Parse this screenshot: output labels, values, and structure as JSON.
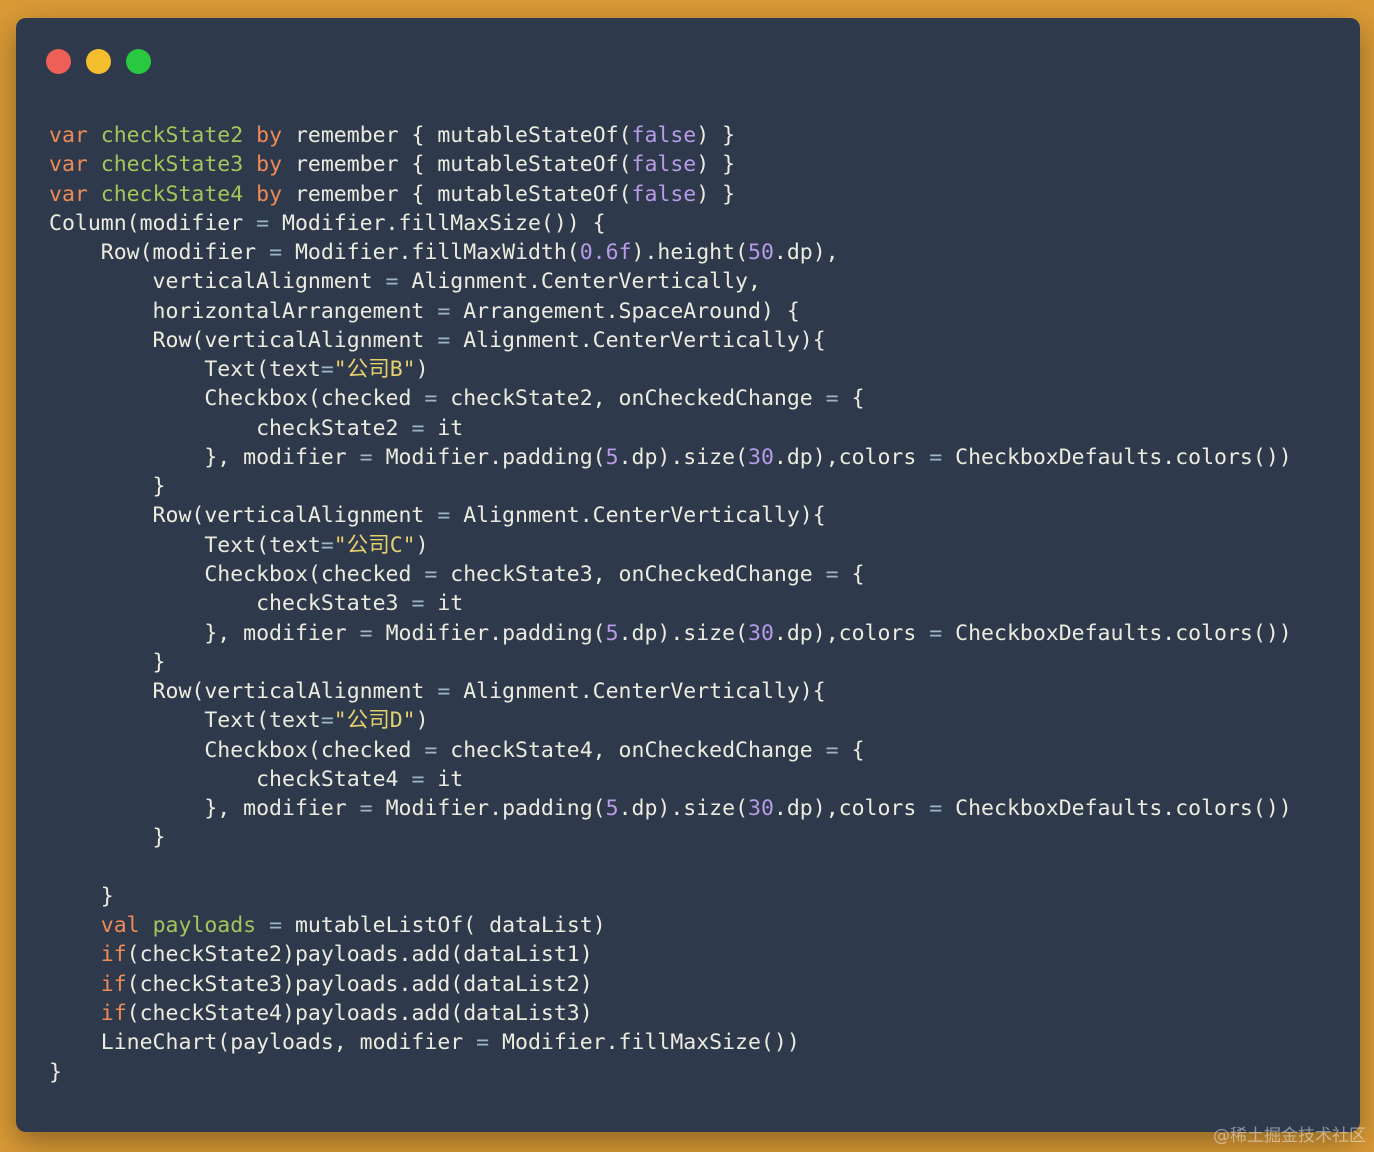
{
  "window": {
    "controls": {
      "close_icon": "red-circle",
      "minimize_icon": "yellow-circle",
      "maximize_icon": "green-circle"
    }
  },
  "colors": {
    "background": "#d99a36",
    "window": "#2e3a4c",
    "keyword": "#ef8a55",
    "variable": "#a7c45b",
    "plain": "#ecebdf",
    "operator": "#9fb6c9",
    "literal": "#b89be6",
    "string": "#e5cf6e"
  },
  "code": {
    "lines": [
      [
        [
          "kw",
          "var"
        ],
        [
          "plain",
          " "
        ],
        [
          "var",
          "checkState2"
        ],
        [
          "plain",
          " "
        ],
        [
          "kw",
          "by"
        ],
        [
          "plain",
          " remember { mutableStateOf("
        ],
        [
          "bool",
          "false"
        ],
        [
          "plain",
          ") }"
        ]
      ],
      [
        [
          "kw",
          "var"
        ],
        [
          "plain",
          " "
        ],
        [
          "var",
          "checkState3"
        ],
        [
          "plain",
          " "
        ],
        [
          "kw",
          "by"
        ],
        [
          "plain",
          " remember { mutableStateOf("
        ],
        [
          "bool",
          "false"
        ],
        [
          "plain",
          ") }"
        ]
      ],
      [
        [
          "kw",
          "var"
        ],
        [
          "plain",
          " "
        ],
        [
          "var",
          "checkState4"
        ],
        [
          "plain",
          " "
        ],
        [
          "kw",
          "by"
        ],
        [
          "plain",
          " remember { mutableStateOf("
        ],
        [
          "bool",
          "false"
        ],
        [
          "plain",
          ") }"
        ]
      ],
      [
        [
          "plain",
          "Column(modifier "
        ],
        [
          "op",
          "="
        ],
        [
          "plain",
          " Modifier.fillMaxSize()) {"
        ]
      ],
      [
        [
          "plain",
          "    Row(modifier "
        ],
        [
          "op",
          "="
        ],
        [
          "plain",
          " Modifier.fillMaxWidth("
        ],
        [
          "num",
          "0.6f"
        ],
        [
          "plain",
          ").height("
        ],
        [
          "num",
          "50"
        ],
        [
          "plain",
          ".dp),"
        ]
      ],
      [
        [
          "plain",
          "        verticalAlignment "
        ],
        [
          "op",
          "="
        ],
        [
          "plain",
          " Alignment.CenterVertically,"
        ]
      ],
      [
        [
          "plain",
          "        horizontalArrangement "
        ],
        [
          "op",
          "="
        ],
        [
          "plain",
          " Arrangement.SpaceAround) {"
        ]
      ],
      [
        [
          "plain",
          "        Row(verticalAlignment "
        ],
        [
          "op",
          "="
        ],
        [
          "plain",
          " Alignment.CenterVertically){"
        ]
      ],
      [
        [
          "plain",
          "            Text(text"
        ],
        [
          "op",
          "="
        ],
        [
          "str",
          "\"公司B\""
        ],
        [
          "plain",
          ")"
        ]
      ],
      [
        [
          "plain",
          "            Checkbox(checked "
        ],
        [
          "op",
          "="
        ],
        [
          "plain",
          " checkState2, onCheckedChange "
        ],
        [
          "op",
          "="
        ],
        [
          "plain",
          " {"
        ]
      ],
      [
        [
          "plain",
          "                checkState2 "
        ],
        [
          "op",
          "="
        ],
        [
          "plain",
          " it"
        ]
      ],
      [
        [
          "plain",
          "            }, modifier "
        ],
        [
          "op",
          "="
        ],
        [
          "plain",
          " Modifier.padding("
        ],
        [
          "num",
          "5"
        ],
        [
          "plain",
          ".dp).size("
        ],
        [
          "num",
          "30"
        ],
        [
          "plain",
          ".dp),colors "
        ],
        [
          "op",
          "="
        ],
        [
          "plain",
          " CheckboxDefaults.colors())"
        ]
      ],
      [
        [
          "plain",
          "        }"
        ]
      ],
      [
        [
          "plain",
          "        Row(verticalAlignment "
        ],
        [
          "op",
          "="
        ],
        [
          "plain",
          " Alignment.CenterVertically){"
        ]
      ],
      [
        [
          "plain",
          "            Text(text"
        ],
        [
          "op",
          "="
        ],
        [
          "str",
          "\"公司C\""
        ],
        [
          "plain",
          ")"
        ]
      ],
      [
        [
          "plain",
          "            Checkbox(checked "
        ],
        [
          "op",
          "="
        ],
        [
          "plain",
          " checkState3, onCheckedChange "
        ],
        [
          "op",
          "="
        ],
        [
          "plain",
          " {"
        ]
      ],
      [
        [
          "plain",
          "                checkState3 "
        ],
        [
          "op",
          "="
        ],
        [
          "plain",
          " it"
        ]
      ],
      [
        [
          "plain",
          "            }, modifier "
        ],
        [
          "op",
          "="
        ],
        [
          "plain",
          " Modifier.padding("
        ],
        [
          "num",
          "5"
        ],
        [
          "plain",
          ".dp).size("
        ],
        [
          "num",
          "30"
        ],
        [
          "plain",
          ".dp),colors "
        ],
        [
          "op",
          "="
        ],
        [
          "plain",
          " CheckboxDefaults.colors())"
        ]
      ],
      [
        [
          "plain",
          "        }"
        ]
      ],
      [
        [
          "plain",
          "        Row(verticalAlignment "
        ],
        [
          "op",
          "="
        ],
        [
          "plain",
          " Alignment.CenterVertically){"
        ]
      ],
      [
        [
          "plain",
          "            Text(text"
        ],
        [
          "op",
          "="
        ],
        [
          "str",
          "\"公司D\""
        ],
        [
          "plain",
          ")"
        ]
      ],
      [
        [
          "plain",
          "            Checkbox(checked "
        ],
        [
          "op",
          "="
        ],
        [
          "plain",
          " checkState4, onCheckedChange "
        ],
        [
          "op",
          "="
        ],
        [
          "plain",
          " {"
        ]
      ],
      [
        [
          "plain",
          "                checkState4 "
        ],
        [
          "op",
          "="
        ],
        [
          "plain",
          " it"
        ]
      ],
      [
        [
          "plain",
          "            }, modifier "
        ],
        [
          "op",
          "="
        ],
        [
          "plain",
          " Modifier.padding("
        ],
        [
          "num",
          "5"
        ],
        [
          "plain",
          ".dp).size("
        ],
        [
          "num",
          "30"
        ],
        [
          "plain",
          ".dp),colors "
        ],
        [
          "op",
          "="
        ],
        [
          "plain",
          " CheckboxDefaults.colors())"
        ]
      ],
      [
        [
          "plain",
          "        }"
        ]
      ],
      [
        [
          "plain",
          ""
        ]
      ],
      [
        [
          "plain",
          "    }"
        ]
      ],
      [
        [
          "plain",
          "    "
        ],
        [
          "kw",
          "val"
        ],
        [
          "plain",
          " "
        ],
        [
          "var",
          "payloads"
        ],
        [
          "plain",
          " "
        ],
        [
          "op",
          "="
        ],
        [
          "plain",
          " mutableListOf( dataList)"
        ]
      ],
      [
        [
          "plain",
          "    "
        ],
        [
          "kw",
          "if"
        ],
        [
          "plain",
          "(checkState2)payloads.add(dataList1)"
        ]
      ],
      [
        [
          "plain",
          "    "
        ],
        [
          "kw",
          "if"
        ],
        [
          "plain",
          "(checkState3)payloads.add(dataList2)"
        ]
      ],
      [
        [
          "plain",
          "    "
        ],
        [
          "kw",
          "if"
        ],
        [
          "plain",
          "(checkState4)payloads.add(dataList3)"
        ]
      ],
      [
        [
          "plain",
          "    LineChart(payloads, modifier "
        ],
        [
          "op",
          "="
        ],
        [
          "plain",
          " Modifier.fillMaxSize())"
        ]
      ],
      [
        [
          "plain",
          "}"
        ]
      ]
    ]
  },
  "watermark": {
    "text": "@稀土掘金技术社区"
  }
}
